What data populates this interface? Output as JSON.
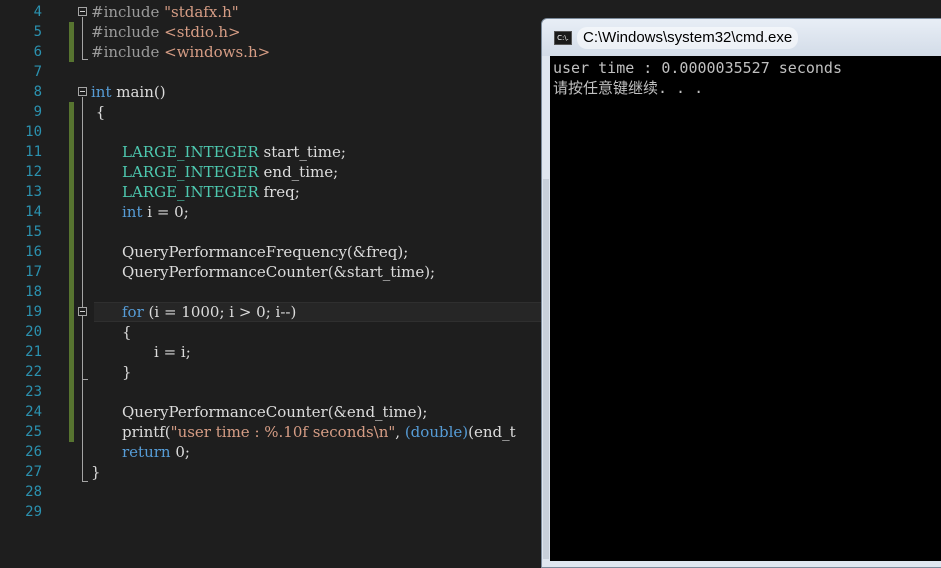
{
  "editor": {
    "line_numbers": [
      "4",
      "5",
      "6",
      "7",
      "8",
      "9",
      "10",
      "11",
      "12",
      "13",
      "14",
      "15",
      "16",
      "17",
      "18",
      "19",
      "20",
      "21",
      "22",
      "23",
      "24",
      "25",
      "26",
      "27",
      "28",
      "29"
    ],
    "lines": {
      "l4_a": "#include ",
      "l4_b": "\"stdafx.h\"",
      "l5_a": "#include ",
      "l5_b": "<stdio.h>",
      "l6_a": "#include ",
      "l6_b": "<windows.h>",
      "l8_a": "int",
      "l8_b": " main()",
      "l9": " {",
      "l11_a": "LARGE_INTEGER",
      "l11_b": " start_time;",
      "l12_a": "LARGE_INTEGER",
      "l12_b": " end_time;",
      "l13_a": "LARGE_INTEGER",
      "l13_b": " freq;",
      "l14_a": "int",
      "l14_b": " i = 0;",
      "l16": "QueryPerformanceFrequency(&freq);",
      "l17": "QueryPerformanceCounter(&start_time);",
      "l19_a": "for",
      "l19_b": " (i = 1000; i > 0; i--)",
      "l20": "{",
      "l21": "i = i;",
      "l22": "}",
      "l24": "QueryPerformanceCounter(&end_time);",
      "l25_a": "printf(",
      "l25_b": "\"user time : %.10f seconds\\n\"",
      "l25_c": ", ",
      "l25_d": "(double)",
      "l25_e": "(end_t",
      "l26_a": "return",
      "l26_b": " 0;",
      "l27": "}"
    }
  },
  "console": {
    "title": "C:\\Windows\\system32\\cmd.exe",
    "icon": "console-icon",
    "icon_text": "C:\\.",
    "output_line_1": "user time : 0.0000035527 seconds",
    "output_line_2": "请按任意键继续. . ."
  }
}
